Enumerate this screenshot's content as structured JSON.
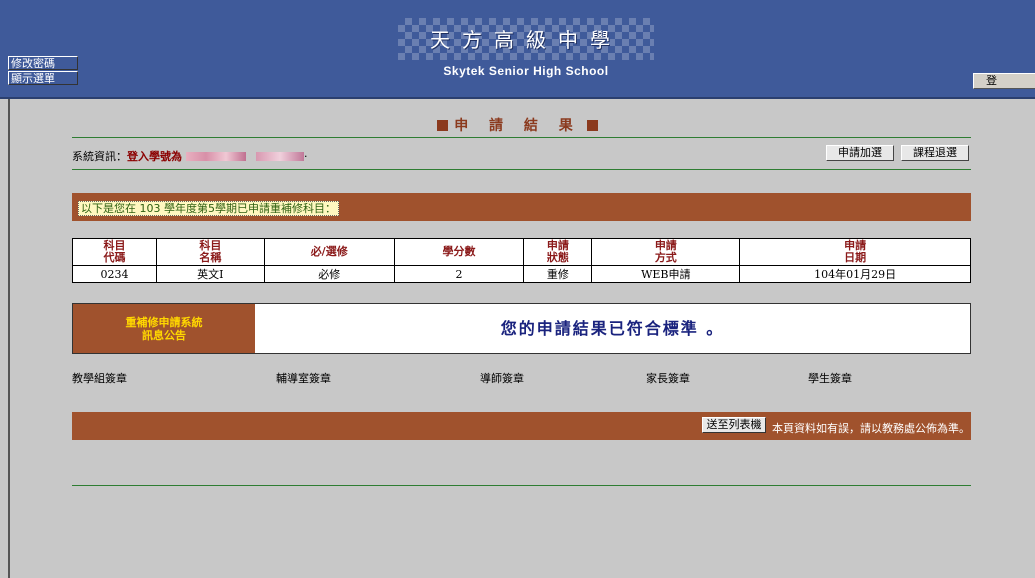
{
  "header": {
    "school_name": "天方高級中學",
    "school_name_en": "Skytek Senior High School",
    "change_password": "修改密碼",
    "show_menu": "顯示選單",
    "logout": "登 出"
  },
  "page_title": "申 請 結 果",
  "sysinfo": {
    "label": "系統資訊：",
    "value": "登入學號為",
    "suffix": "·"
  },
  "actions": {
    "apply_add": "申請加選",
    "course_drop": "課程退選"
  },
  "banner": "以下是您在 103 學年度第5學期已申請重補修科目：",
  "table": {
    "headers": [
      [
        "科目",
        "代碼"
      ],
      [
        "科目",
        "名稱"
      ],
      [
        "必/選修"
      ],
      [
        "學分數"
      ],
      [
        "申請",
        "狀態"
      ],
      [
        "申請",
        "方式"
      ],
      [
        "申請",
        "日期"
      ]
    ],
    "rows": [
      [
        "0234",
        "英文Ⅰ",
        "必修",
        "2",
        "重修",
        "WEB申請",
        "104年01月29日"
      ]
    ]
  },
  "notice": {
    "title_line1": "重補修申請系統",
    "title_line2": "訊息公告",
    "message": "您的申請結果已符合標準 。"
  },
  "signatures": [
    "教學組簽章",
    "輔導室簽章",
    "導師簽章",
    "家長簽章",
    "學生簽章"
  ],
  "footer": {
    "print_button": "送至列表機",
    "note": "本頁資料如有誤，請以教務處公佈為準。"
  },
  "colors": {
    "header_blue": "#3f5a9a",
    "brown": "#a0522d",
    "title_brown": "#8b3a1e",
    "line_green": "#2e7d32"
  }
}
